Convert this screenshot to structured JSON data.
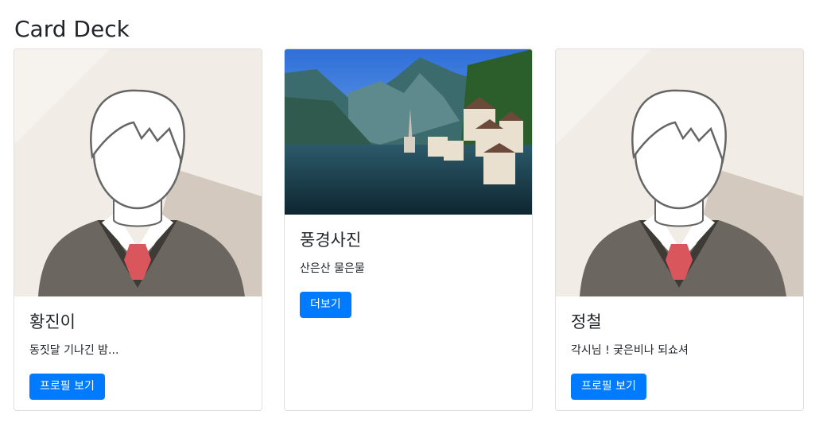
{
  "page": {
    "title": "Card Deck"
  },
  "cards": [
    {
      "title": "황진이",
      "text": "동짓달 기나긴 밤...",
      "button": "프로필 보기",
      "image": "avatar"
    },
    {
      "title": "풍경사진",
      "text": "산은산 물은물",
      "button": "더보기",
      "image": "landscape"
    },
    {
      "title": "정철",
      "text": "각시님 ! 궂은비나 되쇼셔",
      "button": "프로필 보기",
      "image": "avatar"
    }
  ],
  "colors": {
    "button": "#007bff",
    "border": "rgba(0,0,0,0.125)"
  }
}
